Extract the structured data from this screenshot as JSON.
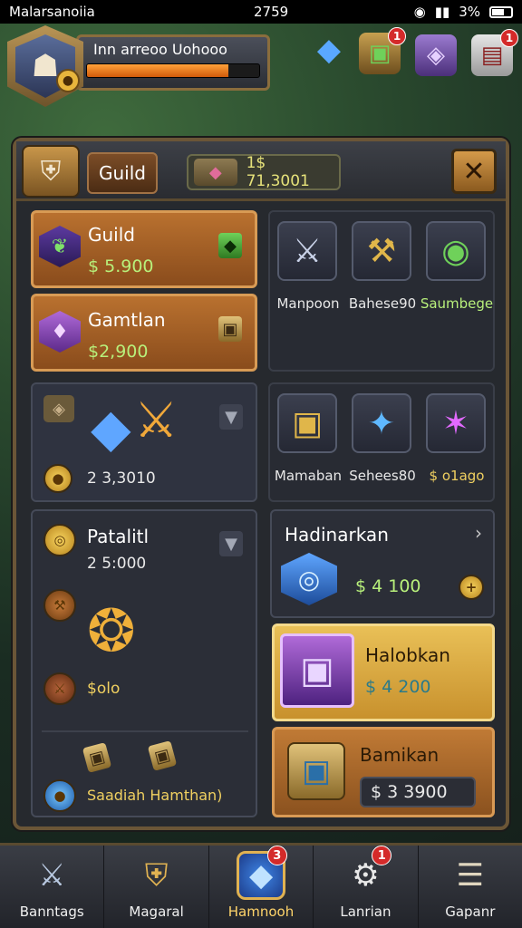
{
  "status_bar": {
    "carrier": "Malarsanoiia",
    "time": "2759",
    "battery": "3%"
  },
  "player": {
    "name": "Inn arreoo Uohooo",
    "xp_fraction": 0.82,
    "rank_icon": "coin-icon"
  },
  "hud_icons": [
    {
      "name": "blue-crystal-icon",
      "glyph": "◆",
      "badge": ""
    },
    {
      "name": "green-chest-icon",
      "glyph": "▣",
      "badge": "1"
    },
    {
      "name": "purple-gem-chest-icon",
      "glyph": "◈",
      "badge": ""
    },
    {
      "name": "mail-box-icon",
      "glyph": "▤",
      "badge": "1"
    }
  ],
  "header": {
    "tab_label": "Guild",
    "currency_value": "1$ 71,3001",
    "close_glyph": "✕"
  },
  "offers": {
    "guild": {
      "title": "Guild",
      "price": "$ 5.900"
    },
    "gamtlan": {
      "title": "Gamtlan",
      "price": "$2,900"
    },
    "crystal": {
      "price": "2 3,3010"
    },
    "patalitl": {
      "title": "Patalitl",
      "price": "2 5:000",
      "item_price": "$olo",
      "footer": "Saadiah Hamthan)"
    },
    "hadinarkan": {
      "title": "Hadinarkan",
      "price": "$ 4 100"
    },
    "halobkan": {
      "title": "Halobkan",
      "price": "$ 4 200"
    },
    "bamikan": {
      "title": "Bamikan",
      "price": "$ 3 3900"
    }
  },
  "item_grid_top": [
    {
      "label": "Manpoon",
      "glyph": "⚔",
      "color": "#e8e8e8"
    },
    {
      "label": "Bahese90",
      "glyph": "⚒",
      "color": "#e8e8e8"
    },
    {
      "label": "Saumbege",
      "glyph": "◉",
      "color": "#b8f07b"
    }
  ],
  "item_grid_bottom": [
    {
      "label": "Mamaban",
      "glyph": "▣",
      "color": "#e8e8e8"
    },
    {
      "label": "Sehees80",
      "glyph": "✦",
      "color": "#e8e8e8"
    },
    {
      "label": "$ o1ago",
      "glyph": "✶",
      "color": "#f0d060"
    }
  ],
  "nav": [
    {
      "label": "Banntags",
      "glyph": "⚔",
      "badge": ""
    },
    {
      "label": "Magaral",
      "glyph": "⛨",
      "badge": ""
    },
    {
      "label": "Hamnooh",
      "glyph": "◆",
      "badge": "3",
      "active": true
    },
    {
      "label": "Lanrian",
      "glyph": "⚙",
      "badge": "1"
    },
    {
      "label": "Gapanr",
      "glyph": "☰",
      "badge": ""
    }
  ]
}
